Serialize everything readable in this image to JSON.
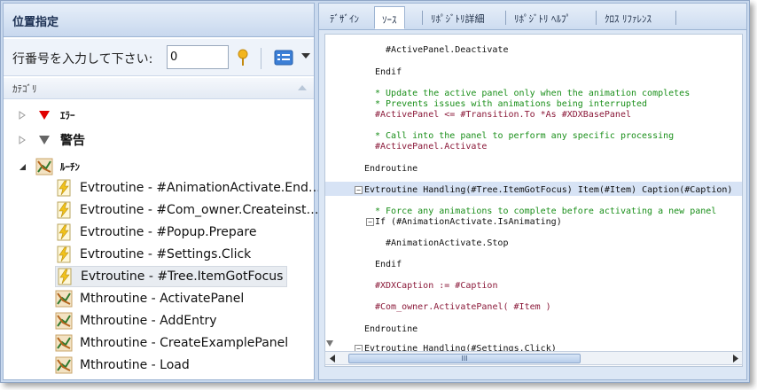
{
  "left_panel": {
    "title": "位置指定",
    "goto_label": "行番号を入力して下さい:",
    "goto_value": "0",
    "category_header": "ｶﾃｺﾞﾘ",
    "tree": {
      "errors": "ｴﾗｰ",
      "warnings": "警告",
      "routines": "ﾙｰﾁﾝ",
      "items": [
        "Evtroutine - #AnimationActivate.End…",
        "Evtroutine - #Com_owner.Createinst…",
        "Evtroutine - #Popup.Prepare",
        "Evtroutine - #Settings.Click",
        "Evtroutine - #Tree.ItemGotFocus",
        "Mthroutine - ActivatePanel",
        "Mthroutine - AddEntry",
        "Mthroutine - CreateExamplePanel",
        "Mthroutine - Load"
      ]
    }
  },
  "right_panel": {
    "tabs": [
      "ﾃﾞｻﾞｲﾝ",
      "ｿｰｽ",
      "ﾘﾎﾟｼﾞﾄﾘ詳細",
      "ﾘﾎﾟｼﾞﾄﾘ ﾍﾙﾌﾟ",
      "ｸﾛｽ ﾘﾌｧﾚﾝｽ"
    ],
    "active_tab": "ｿｰｽ",
    "code_lines": [
      {
        "text": "#ActivePanel.Deactivate",
        "kind": "normal"
      },
      {
        "text": "Endif",
        "kind": "normal"
      },
      {
        "text": "* Update the active panel only when the animation completes",
        "kind": "comment"
      },
      {
        "text": "* Prevents issues with animations being interrupted",
        "kind": "comment"
      },
      {
        "text": "#ActivePanel <= #Transition.To *As #XDXBasePanel",
        "kind": "var"
      },
      {
        "text": "* Call into the panel to perform any specific processing",
        "kind": "comment"
      },
      {
        "text": "#ActivePanel.Activate",
        "kind": "var"
      },
      {
        "text": "Endroutine",
        "kind": "normal"
      },
      {
        "text": "Evtroutine Handling(#Tree.ItemGotFocus) Item(#Item) Caption(#Caption)",
        "kind": "normal"
      },
      {
        "text": "* Force any animations to complete before activating a new panel",
        "kind": "comment"
      },
      {
        "text": "If (#AnimationActivate.IsAnimating)",
        "kind": "normal"
      },
      {
        "text": "#AnimationActivate.Stop",
        "kind": "normal"
      },
      {
        "text": "Endif",
        "kind": "normal"
      },
      {
        "text": "#XDXCaption := #Caption",
        "kind": "var"
      },
      {
        "text": "#Com_owner.ActivatePanel( #Item )",
        "kind": "var"
      },
      {
        "text": "Endroutine",
        "kind": "normal"
      },
      {
        "text": "Evtroutine Handling(#Settings.Click)",
        "kind": "normal"
      }
    ],
    "scroll_thumb_label": "III"
  },
  "colors": {
    "comment": "#1a8f1a",
    "variable": "#8b1a3a",
    "error_marker": "#e00000",
    "warning_marker": "#666666"
  }
}
